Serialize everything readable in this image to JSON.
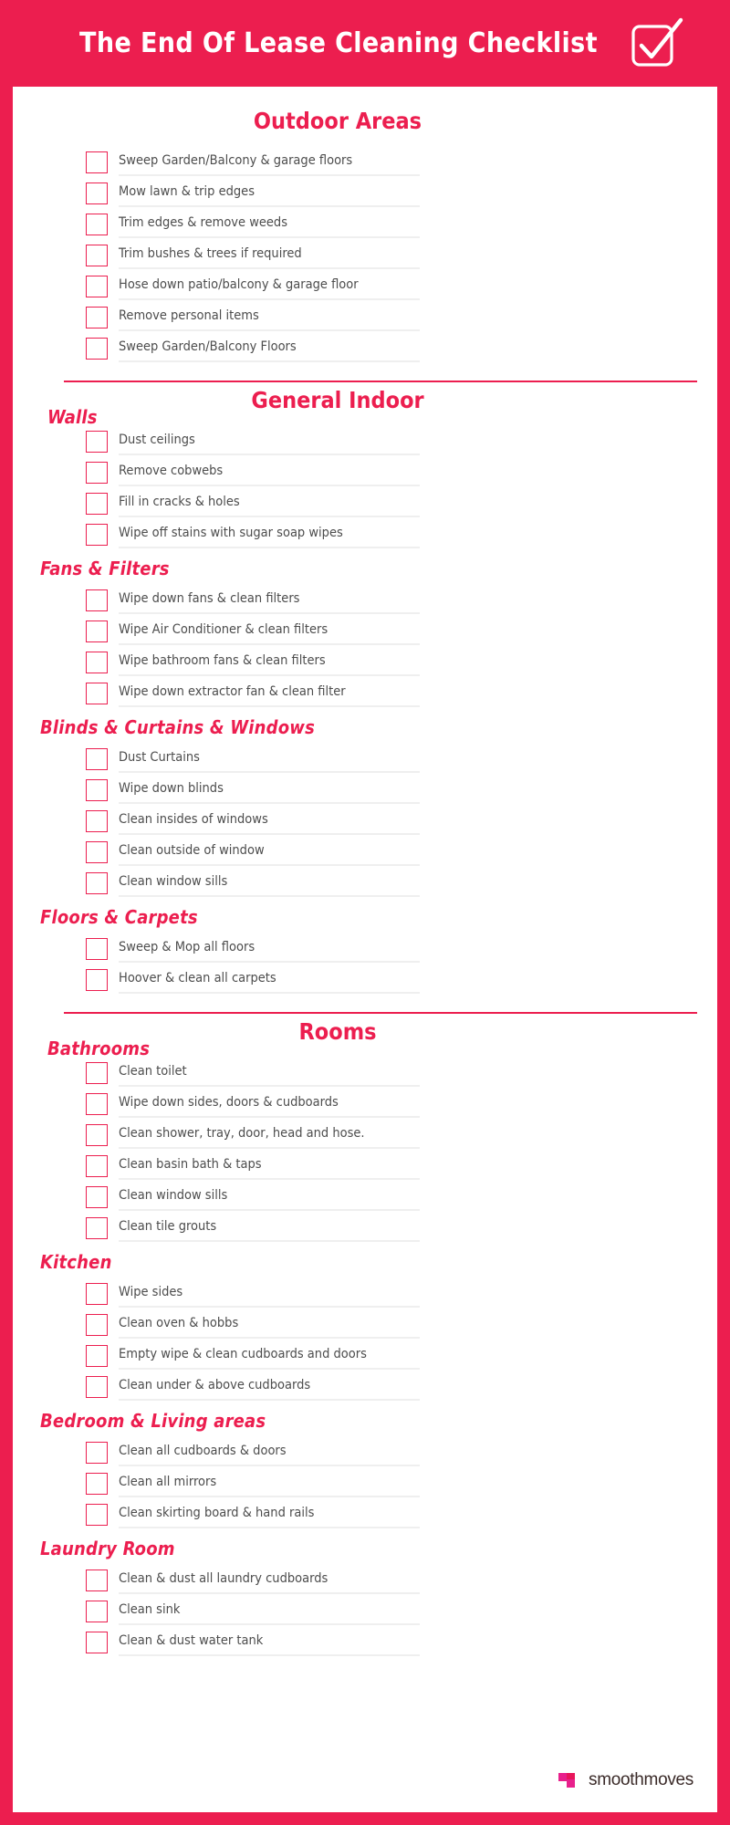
{
  "header": {
    "title": "The End Of Lease Cleaning Checklist",
    "check_icon": "checked-checkbox-icon"
  },
  "sections": [
    {
      "id": "outdoor-areas",
      "title": "Outdoor Areas",
      "groups": [
        {
          "id": "outdoor-areas-main",
          "subhead": null,
          "items": [
            "Sweep Garden/Balcony & garage floors",
            "Mow lawn & trip edges",
            "Trim edges & remove weeds",
            "Trim bushes & trees if required",
            "Hose down patio/balcony & garage floor",
            "Remove personal items",
            "Sweep Garden/Balcony Floors"
          ]
        }
      ]
    },
    {
      "id": "general-indoor",
      "title": "General Indoor",
      "groups": [
        {
          "id": "walls",
          "subhead": "Walls",
          "items": [
            "Dust ceilings",
            "Remove cobwebs",
            "Fill in cracks & holes",
            "Wipe off stains with sugar soap wipes"
          ]
        },
        {
          "id": "fans-filters",
          "subhead": "Fans & Filters",
          "items": [
            "Wipe down fans & clean filters",
            "Wipe Air Conditioner & clean filters",
            "Wipe bathroom fans & clean filters",
            "Wipe down extractor fan & clean filter"
          ]
        },
        {
          "id": "blinds-curtains-windows",
          "subhead": "Blinds & Curtains & Windows",
          "items": [
            "Dust Curtains",
            "Wipe down blinds",
            "Clean insides of windows",
            "Clean outside of window",
            "Clean window sills"
          ]
        },
        {
          "id": "floors-carpets",
          "subhead": "Floors & Carpets",
          "items": [
            "Sweep & Mop all floors",
            "Hoover & clean all carpets"
          ]
        }
      ]
    },
    {
      "id": "rooms",
      "title": "Rooms",
      "groups": [
        {
          "id": "bathrooms",
          "subhead": "Bathrooms",
          "items": [
            "Clean toilet",
            "Wipe down sides, doors & cudboards",
            "Clean shower, tray, door, head and hose.",
            "Clean basin bath & taps",
            "Clean window sills",
            "Clean tile grouts"
          ]
        },
        {
          "id": "kitchen",
          "subhead": "Kitchen",
          "items": [
            "Wipe sides",
            "Clean oven & hobbs",
            "Empty wipe & clean cudboards and doors",
            "Clean under & above cudboards"
          ]
        },
        {
          "id": "bedroom-living-areas",
          "subhead": "Bedroom & Living areas",
          "items": [
            "Clean all cudboards & doors",
            "Clean all mirrors",
            "Clean skirting board & hand rails"
          ]
        },
        {
          "id": "laundry-room",
          "subhead": "Laundry Room",
          "items": [
            "Clean & dust all laundry cudboards",
            "Clean sink",
            "Clean & dust water tank"
          ]
        }
      ]
    }
  ],
  "footer": {
    "brand": "smoothmoves",
    "logo_icon": "smoothmoves-s-logo-icon"
  },
  "colors": {
    "brand_red": "#EC1E4F",
    "logo_magenta": "#E8208C",
    "text_gray": "#4d4d4d",
    "rule_gray": "#efefef",
    "logo_text": "#3a2a28"
  }
}
